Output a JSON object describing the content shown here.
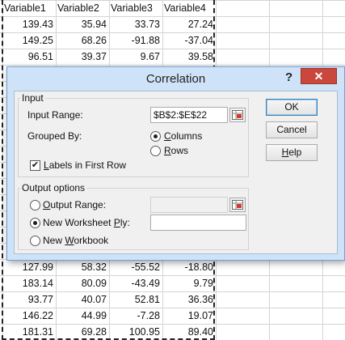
{
  "sheet": {
    "headers": [
      "Variable1",
      "Variable2",
      "Variable3",
      "Variable4"
    ],
    "rows_top": [
      [
        "139.43",
        "35.94",
        "33.73",
        "27.24"
      ],
      [
        "149.25",
        "68.26",
        "-91.88",
        "-37.04"
      ],
      [
        "96.51",
        "39.37",
        "9.67",
        "39.58"
      ]
    ],
    "rows_bottom": [
      [
        "127.99",
        "58.32",
        "-55.52",
        "-18.80"
      ],
      [
        "183.14",
        "80.09",
        "-43.49",
        "9.79"
      ],
      [
        "93.77",
        "40.07",
        "52.81",
        "36.36"
      ],
      [
        "146.22",
        "44.99",
        "-7.28",
        "19.07"
      ],
      [
        "181.31",
        "69.28",
        "100.95",
        "89.40"
      ]
    ]
  },
  "dialog": {
    "title": "Correlation",
    "help_glyph": "?",
    "close_glyph": "✕",
    "input": {
      "group_label": "Input",
      "input_range_label": "Input Range:",
      "input_range_value": "$B$2:$E$22",
      "grouped_by_label": "Grouped By:",
      "columns_label": "Columns",
      "rows_label": "Rows",
      "grouped_by_selected": "Columns",
      "labels_first_row_label": "Labels in First Row",
      "labels_first_row_checked": true,
      "check_glyph": "✔"
    },
    "output": {
      "group_label": "Output options",
      "output_range_label": "Output Range:",
      "new_worksheet_label": "New Worksheet Ply:",
      "new_workbook_label": "New Workbook",
      "selected": "New Worksheet Ply",
      "output_range_value": "",
      "new_worksheet_value": ""
    },
    "buttons": {
      "ok": "OK",
      "cancel": "Cancel",
      "help": "Help"
    }
  },
  "colors": {
    "dialog_frame": "#cfe3f8",
    "close_button": "#c9473d",
    "client_bg": "#f0f0f0"
  }
}
